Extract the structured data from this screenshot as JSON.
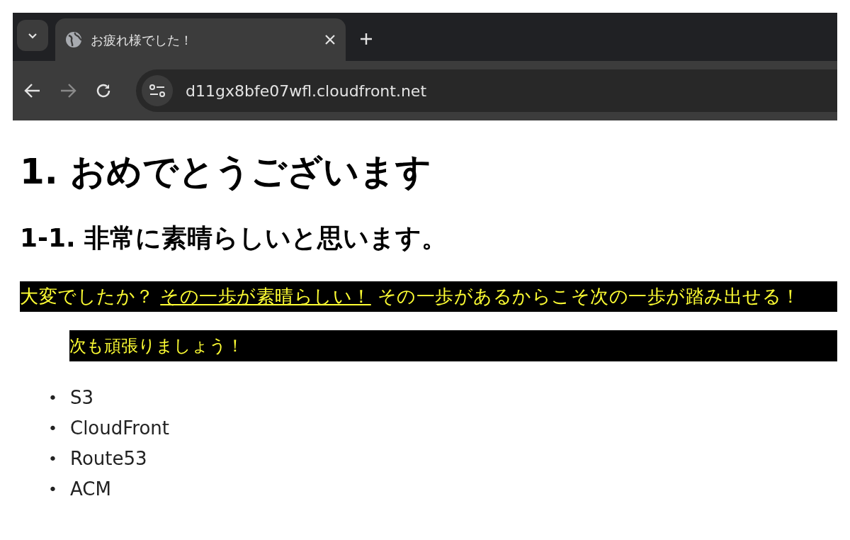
{
  "browser": {
    "tab": {
      "title": "お疲れ様でした！",
      "selected": true
    },
    "address": "d11gx8bfe07wfl.cloudfront.net"
  },
  "page": {
    "heading": "1. おめでとうございます",
    "subheading": "1-1. 非常に素晴らしいと思います。",
    "paragraph": {
      "before": "大変でしたか？",
      "link": "その一歩が素晴らしい！",
      "after": "その一歩があるからこそ次の一歩が踏み出せる！"
    },
    "quote": "次も頑張りましょう！",
    "list": [
      {
        "marker": "•",
        "text": "S3"
      },
      {
        "marker": "•",
        "text": "CloudFront"
      },
      {
        "marker": "•",
        "text": "Route53"
      },
      {
        "marker": "•",
        "text": "ACM"
      }
    ]
  }
}
